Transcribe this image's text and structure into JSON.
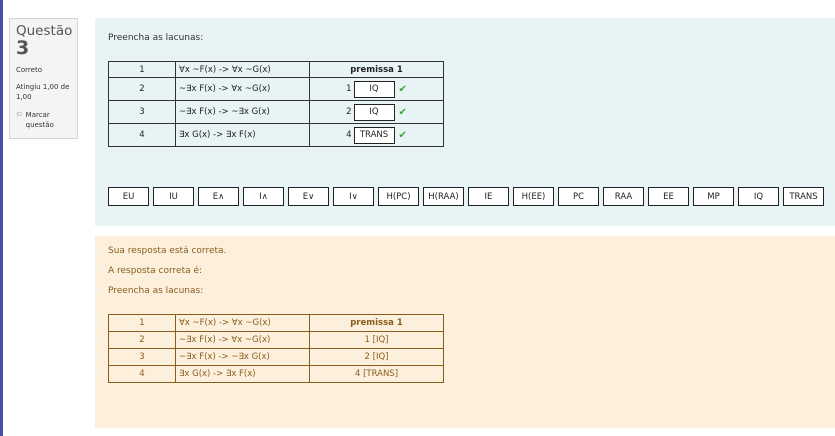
{
  "info": {
    "question_label": "Questão",
    "question_number": "3",
    "state": "Correto",
    "grade": "Atingiu 1,00 de 1,00",
    "flag_label": "Marcar questão"
  },
  "question": {
    "prompt": "Preencha as lacunas:",
    "rows": [
      {
        "num": "1",
        "formula": "∀x ~F(x) -> ∀x ~G(x)",
        "justification": "premissa 1"
      },
      {
        "num": "2",
        "formula": "~∃x F(x) -> ∀x ~G(x)",
        "ref": "1",
        "answer": "IQ"
      },
      {
        "num": "3",
        "formula": "~∃x F(x) -> ~∃x G(x)",
        "ref": "2",
        "answer": "IQ"
      },
      {
        "num": "4",
        "formula": "∃x G(x) -> ∃x F(x)",
        "ref": "4",
        "answer": "TRANS"
      }
    ],
    "choices": [
      "EU",
      "IU",
      "E∧",
      "I∧",
      "E∨",
      "I∨",
      "H(PC)",
      "H(RAA)",
      "IE",
      "H(EE)",
      "PC",
      "RAA",
      "EE",
      "MP",
      "IQ",
      "TRANS"
    ]
  },
  "feedback": {
    "correct_msg": "Sua resposta está correta.",
    "right_answer_label": "A resposta correta é:",
    "prompt": "Preencha as lacunas:",
    "rows": [
      {
        "num": "1",
        "formula": "∀x ~F(x) -> ∀x ~G(x)",
        "justification": "premissa 1"
      },
      {
        "num": "2",
        "formula": "~∃x F(x) -> ∀x ~G(x)",
        "justification": "1 [IQ]"
      },
      {
        "num": "3",
        "formula": "~∃x F(x) -> ~∃x G(x)",
        "justification": "2 [IQ]"
      },
      {
        "num": "4",
        "formula": "∃x G(x) -> ∃x F(x)",
        "justification": "4 [TRANS]"
      }
    ]
  },
  "colors": {
    "accent": "#4a4fa8",
    "correct": "#3aa63a",
    "feedback_text": "#8a5d1c",
    "question_bg": "#e7f3f5",
    "feedback_bg": "#fcefdc"
  }
}
